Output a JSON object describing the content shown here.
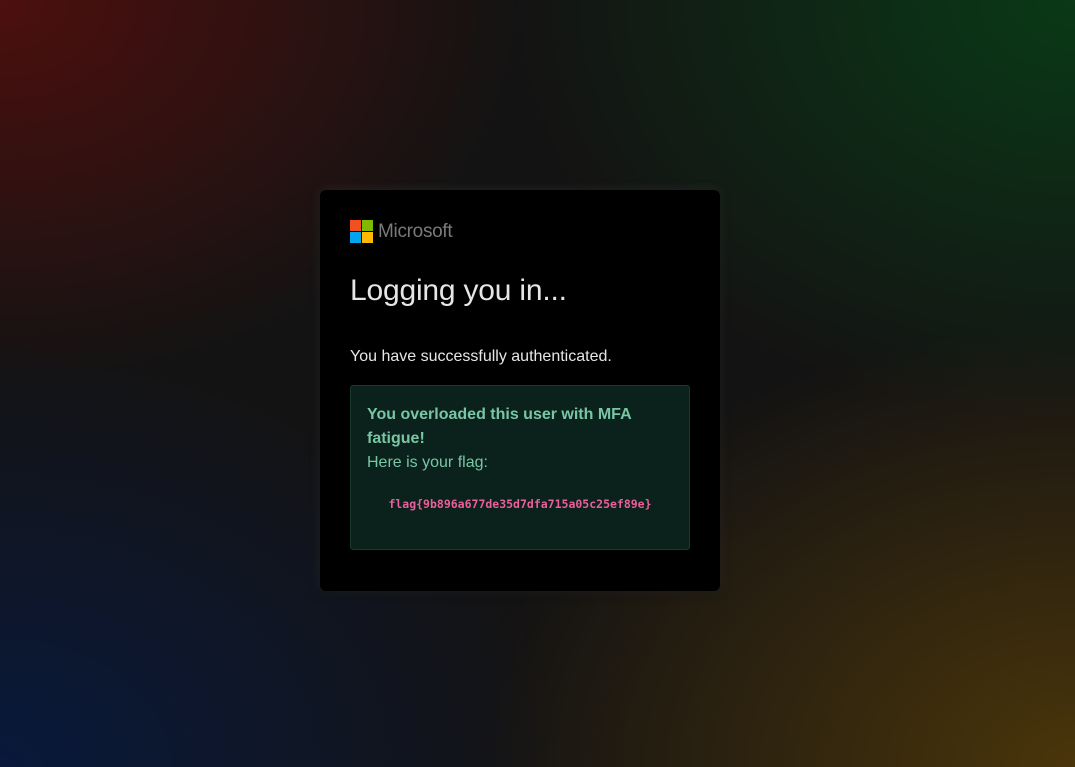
{
  "brand": {
    "name": "Microsoft",
    "logo_icon": "microsoft-logo-icon",
    "logo_colors": [
      "#f25022",
      "#7fba00",
      "#00a4ef",
      "#ffb900"
    ]
  },
  "card": {
    "title": "Logging you in...",
    "message": "You have successfully authenticated."
  },
  "flag_box": {
    "headline": "You overloaded this user with MFA fatigue!",
    "subtext": "Here is your flag:",
    "flag": "flag{9b896a677de35d7dfa715a05c25ef89e}"
  },
  "colors": {
    "card_bg": "#000000",
    "text": "#e6e6e6",
    "success_bg": "#0b211b",
    "success_text": "#78c6a5",
    "flag_text": "#ea5f9c"
  }
}
